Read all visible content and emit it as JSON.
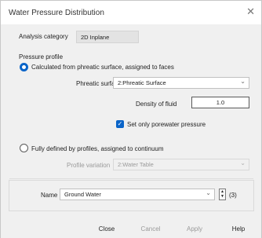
{
  "window": {
    "title": "Water Pressure Distribution",
    "close_glyph": "✕"
  },
  "analysis": {
    "label": "Analysis category",
    "value": "2D Inplane"
  },
  "pressure_profile": {
    "heading": "Pressure profile",
    "option1": {
      "label": "Calculated from phreatic surface, assigned to faces",
      "selected": true,
      "phreatic_label": "Phreatic surface",
      "phreatic_value": "2:Phreatic Surface",
      "density_label": "Density of fluid",
      "density_value": "1.0",
      "porewater_label": "Set only porewater pressure",
      "porewater_checked": true
    },
    "option2": {
      "label": "Fully defined by profiles, assigned to continuum",
      "selected": false,
      "profile_label": "Profile variation",
      "profile_value": "2:Water Table"
    }
  },
  "name_row": {
    "label": "Name",
    "value": "Ground Water",
    "count": "(3)"
  },
  "buttons": {
    "close": "Close",
    "cancel": "Cancel",
    "apply": "Apply",
    "help": "Help"
  },
  "colors": {
    "accent": "#0a64c8",
    "background": "#f0f0f0"
  },
  "icons": {
    "chevron": "chevron-down-icon",
    "check": "check-icon"
  }
}
